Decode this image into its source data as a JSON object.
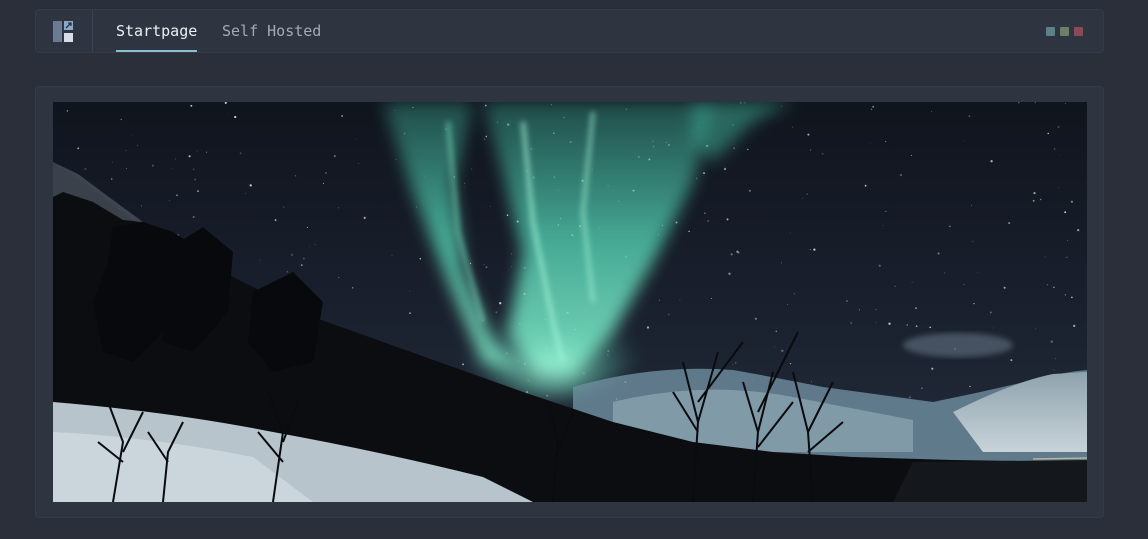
{
  "header": {
    "tabs": [
      {
        "label": "Startpage",
        "active": true
      },
      {
        "label": "Self Hosted",
        "active": false
      }
    ],
    "logo_icon": "layout-grid-icon",
    "window_controls": [
      {
        "icon": "window-dot-icon",
        "color": "#5e8088"
      },
      {
        "icon": "window-dot-icon",
        "color": "#6c7d68"
      },
      {
        "icon": "window-dot-icon",
        "color": "#8a4a55"
      }
    ]
  },
  "main": {
    "hero_image": {
      "icon": "aurora-landscape-image",
      "colors": {
        "sky": "#161b26",
        "aurora": "#5fe0c2",
        "snow": "#c7d2d8",
        "treeline": "#0c0d10"
      }
    }
  },
  "theme": {
    "background": "#2a2f3a",
    "panel": "#2e3440",
    "accent": "#88c0d0",
    "text_active": "#eceff4",
    "text_inactive": "#a3a9b5"
  }
}
